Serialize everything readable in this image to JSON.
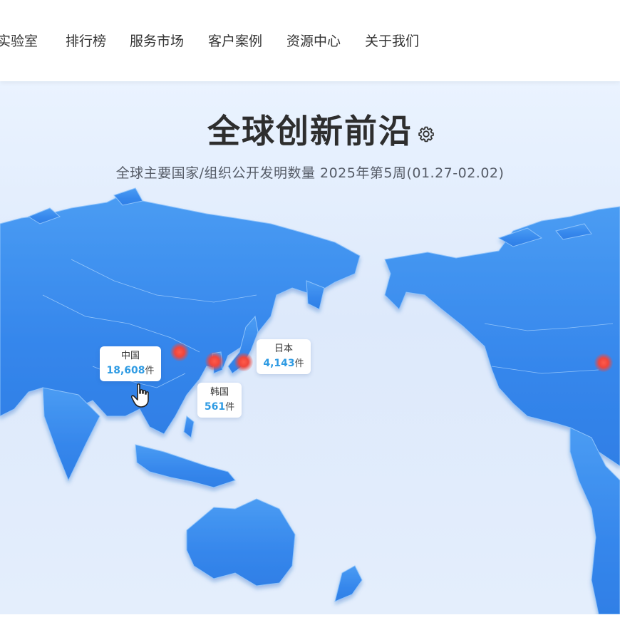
{
  "nav": {
    "items": [
      {
        "label": "实验室"
      },
      {
        "label": "排行榜"
      },
      {
        "label": "服务市场"
      },
      {
        "label": "客户案例"
      },
      {
        "label": "资源中心"
      },
      {
        "label": "关于我们"
      }
    ]
  },
  "hero": {
    "title": "全球创新前沿",
    "subtitle": "全球主要国家/组织公开发明数量 2025年第5周(01.27-02.02)",
    "settings_icon": "gear-icon"
  },
  "map": {
    "land_color": "#3a8ff0",
    "ocean_color": "#e3eefc",
    "hotspot_color": "#f0463c",
    "count_color": "#2f9be3",
    "markers": [
      {
        "name": "中国",
        "count": "18,608",
        "unit": "件"
      },
      {
        "name": "日本",
        "count": "4,143",
        "unit": "件"
      },
      {
        "name": "韩国",
        "count": "561",
        "unit": "件"
      }
    ],
    "pointer_icon": "hand-pointer-icon"
  }
}
